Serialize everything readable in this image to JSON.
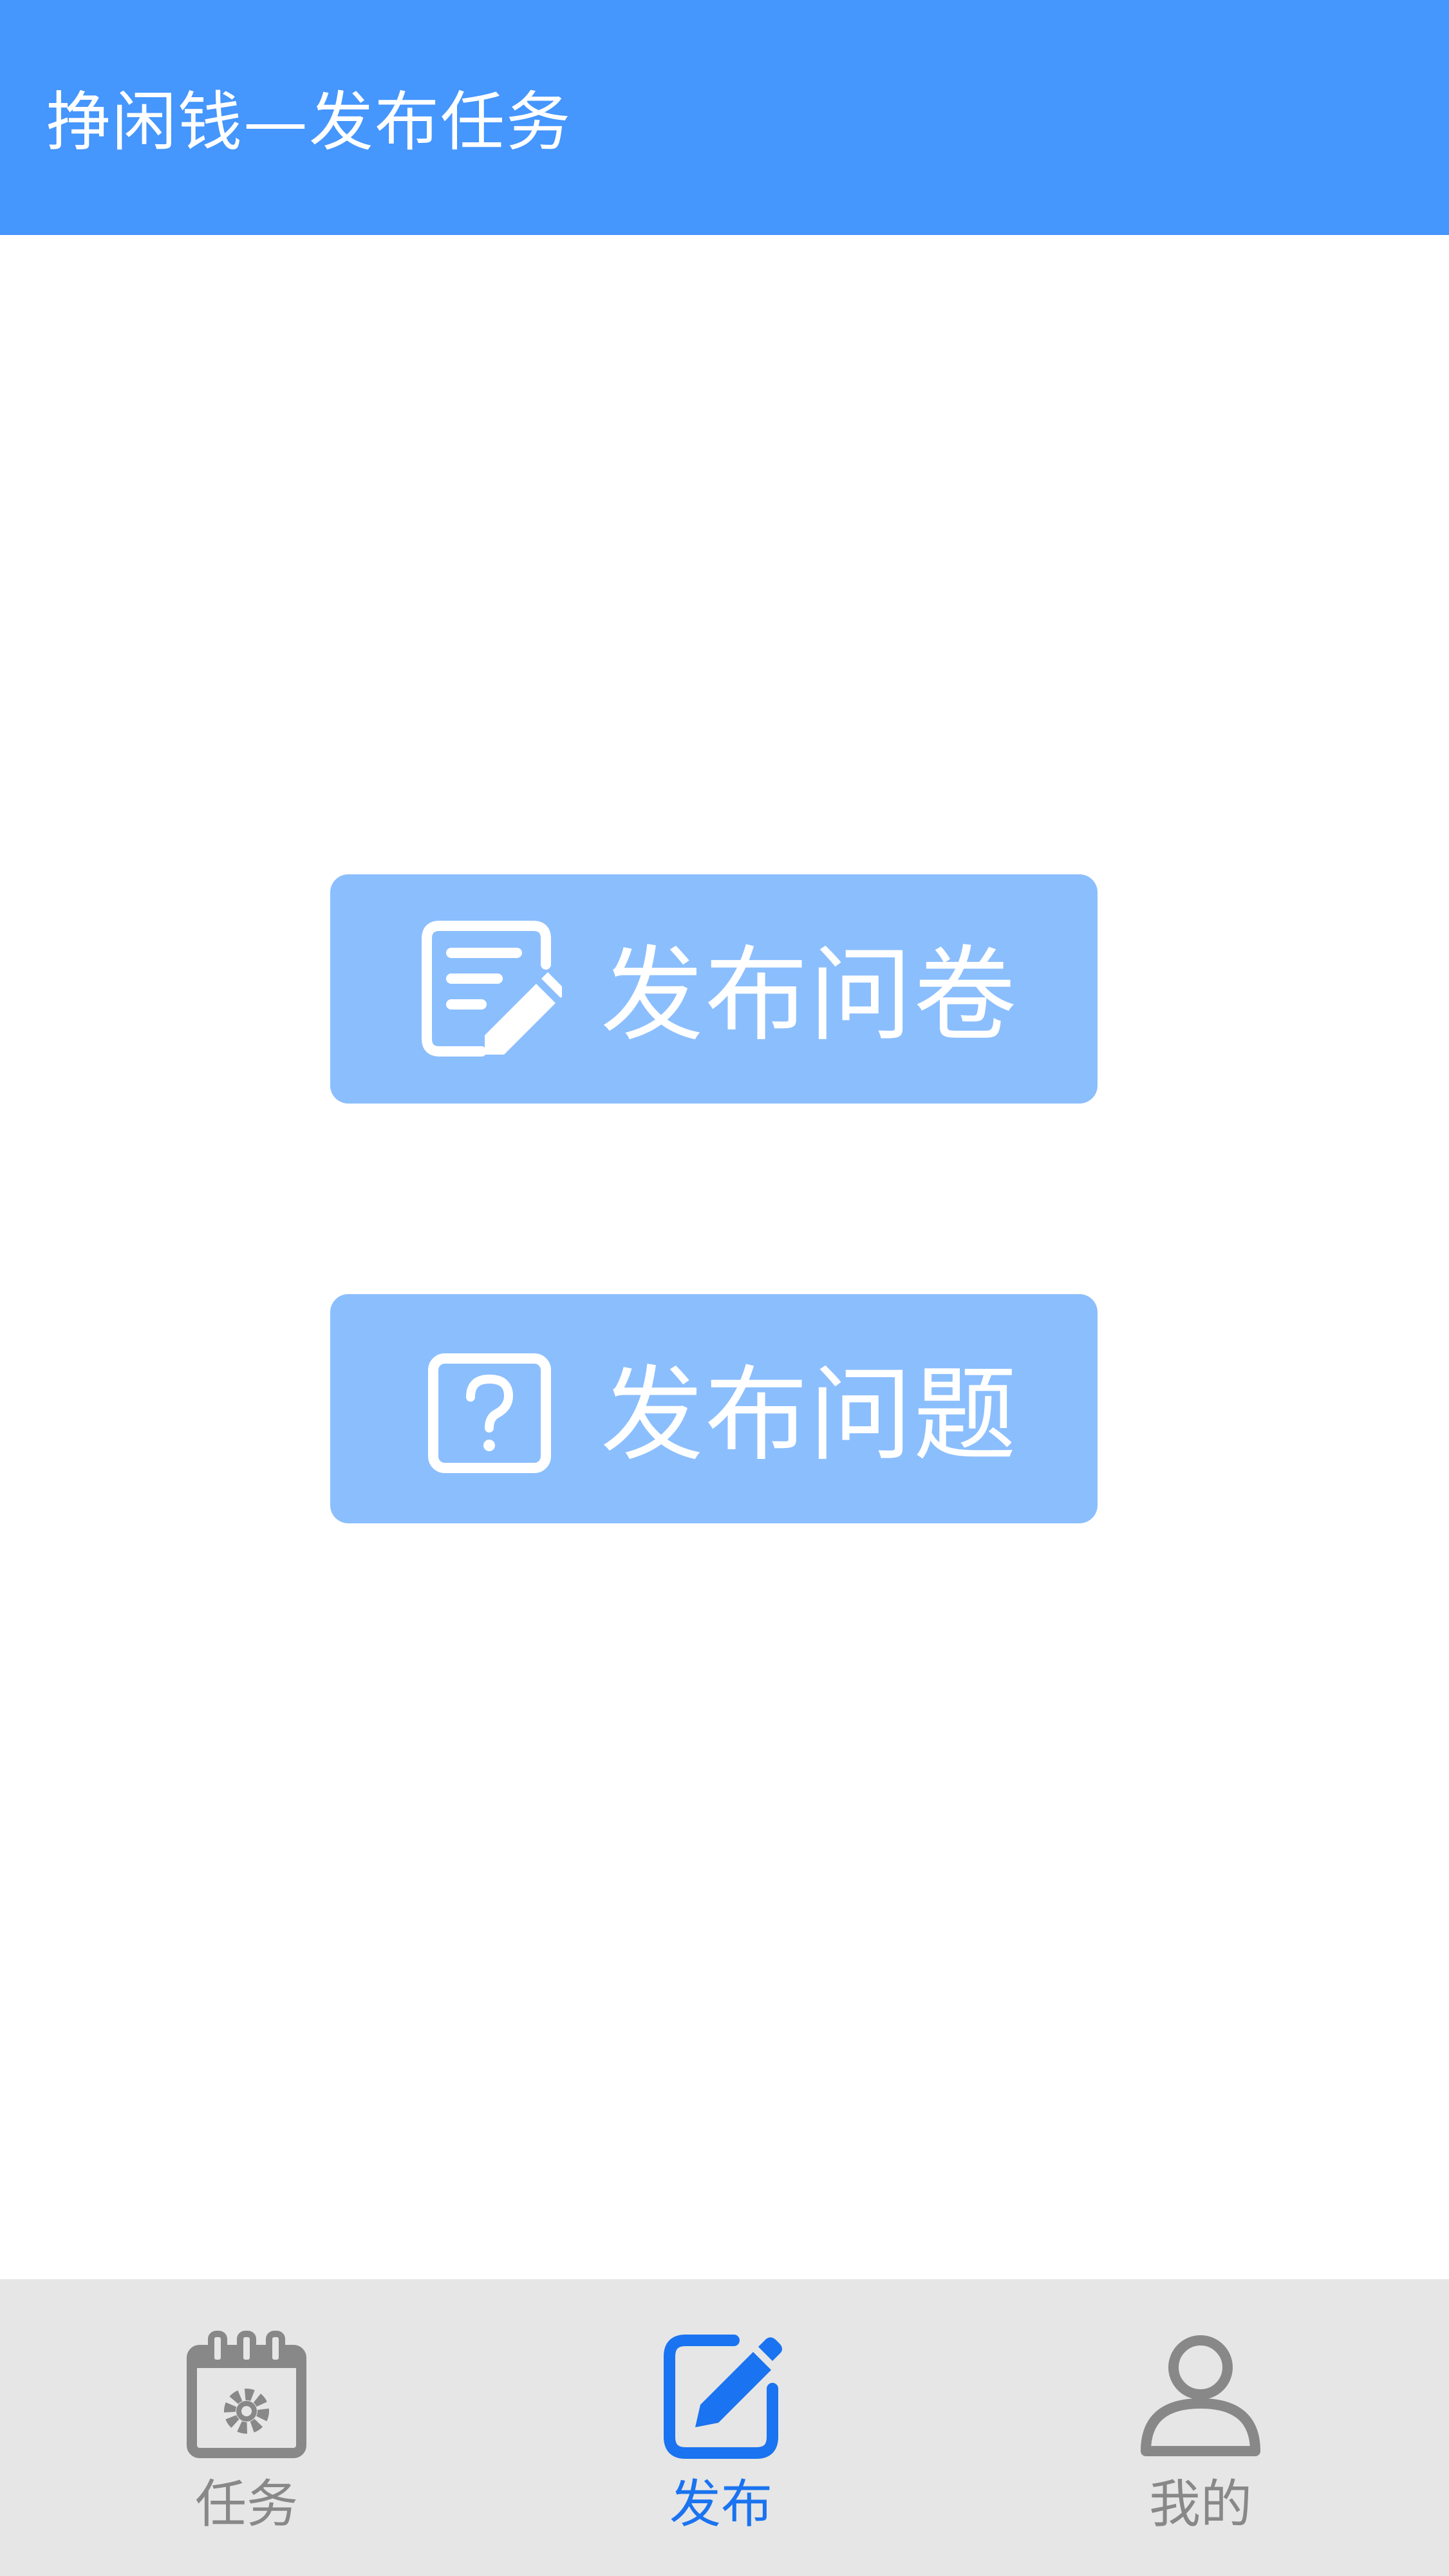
{
  "header": {
    "title": "挣闲钱—发布任务"
  },
  "actions": [
    {
      "label": "发布问卷",
      "icon": "edit-document-icon"
    },
    {
      "label": "发布问题",
      "icon": "question-box-icon"
    }
  ],
  "tabbar": {
    "tabs": [
      {
        "label": "任务",
        "icon": "calendar-gear-icon",
        "active": false
      },
      {
        "label": "发布",
        "icon": "edit-pencil-icon",
        "active": true
      },
      {
        "label": "我的",
        "icon": "user-icon",
        "active": false
      }
    ]
  },
  "colors": {
    "header_bg": "#4596fd",
    "button_bg": "#8bbefd",
    "tabbar_bg": "#e6e6e6",
    "tab_active": "#1a73f0",
    "tab_inactive": "#888888"
  }
}
